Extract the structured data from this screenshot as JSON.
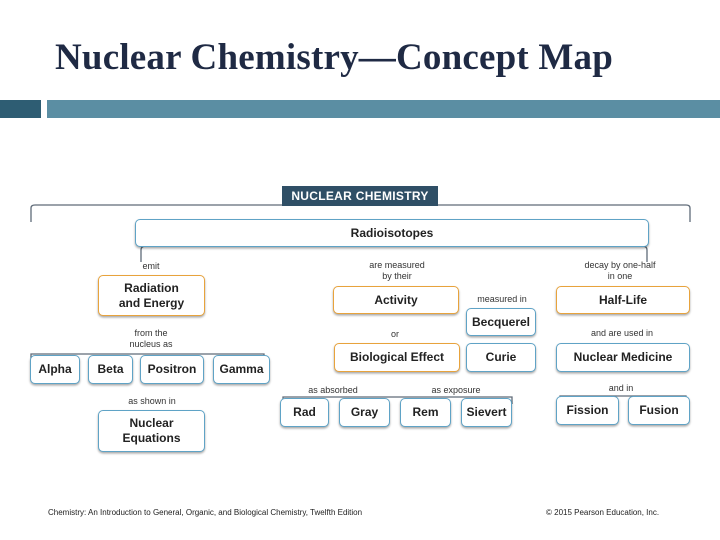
{
  "slide": {
    "title": "Nuclear Chemistry—Concept Map",
    "footer_left": "Chemistry: An Introduction to General, Organic, and Biological Chemistry, Twelfth Edition",
    "footer_right": "© 2015 Pearson Education, Inc."
  },
  "diagram": {
    "banner": "NUCLEAR CHEMISTRY",
    "nodes": {
      "radioisotopes": "Radioisotopes",
      "radiation_energy": "Radiation\nand Energy",
      "activity": "Activity",
      "half_life": "Half-Life",
      "becquerel": "Becquerel",
      "biological_effect": "Biological Effect",
      "curie": "Curie",
      "nuclear_medicine": "Nuclear Medicine",
      "alpha": "Alpha",
      "beta": "Beta",
      "positron": "Positron",
      "gamma": "Gamma",
      "rad": "Rad",
      "gray": "Gray",
      "rem": "Rem",
      "sievert": "Sievert",
      "fission": "Fission",
      "fusion": "Fusion",
      "nuclear_equations": "Nuclear\nEquations"
    },
    "links": {
      "emit": "emit",
      "are_measured_by_their": "are measured\nby their",
      "decay_by_one_half": "decay by one-half\nin one",
      "measured_in": "measured in",
      "or": "or",
      "and_are_used_in": "and are used in",
      "from_the_nucleus_as": "from the\nnucleus as",
      "as_absorbed": "as absorbed",
      "as_exposure": "as exposure",
      "and_in": "and in",
      "as_shown_in": "as shown in"
    },
    "colors": {
      "banner": "#2f4f66",
      "node_border": "#5fa3c6",
      "highlight_border": "#e8a33c",
      "accent_bar": "#5b8ea3",
      "accent_bar_dark": "#2e5d73",
      "title": "#1f2a44"
    }
  }
}
